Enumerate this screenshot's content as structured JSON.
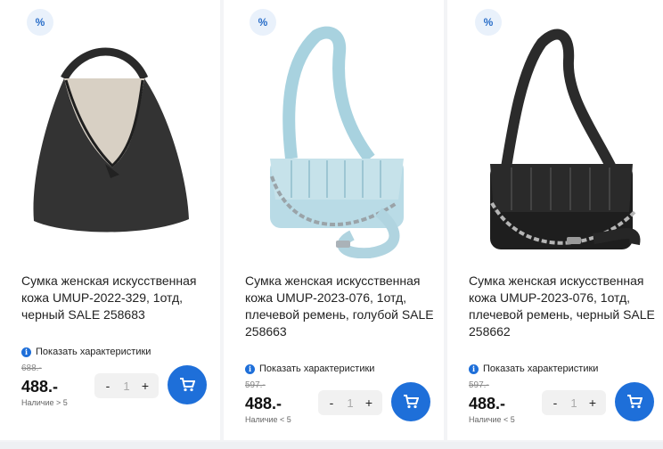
{
  "colors": {
    "accent": "#1e6fd9",
    "badge_bg": "#e9f1fb"
  },
  "products": [
    {
      "badge": "%",
      "title": "Сумка женская искусственная кожа UMUP-2022-329, 1отд, черный SALE 258683",
      "specs_label": "Показать характеристики",
      "old_price": "688.-",
      "price": "488.-",
      "stock": "Наличие > 5",
      "qty_minus": "-",
      "qty_value": "1",
      "qty_plus": "+",
      "cart_icon": "cart-icon"
    },
    {
      "badge": "%",
      "title": "Сумка женская искусственная кожа UMUP-2023-076, 1отд, плечевой ремень, голубой SALE 258663",
      "specs_label": "Показать характеристики",
      "old_price": "597.-",
      "price": "488.-",
      "stock": "Наличие < 5",
      "qty_minus": "-",
      "qty_value": "1",
      "qty_plus": "+",
      "cart_icon": "cart-icon"
    },
    {
      "badge": "%",
      "title": "Сумка женская искусственная кожа UMUP-2023-076, 1отд, плечевой ремень, черный SALE 258662",
      "specs_label": "Показать характеристики",
      "old_price": "597.-",
      "price": "488.-",
      "stock": "Наличие < 5",
      "qty_minus": "-",
      "qty_value": "1",
      "qty_plus": "+",
      "cart_icon": "cart-icon"
    }
  ]
}
